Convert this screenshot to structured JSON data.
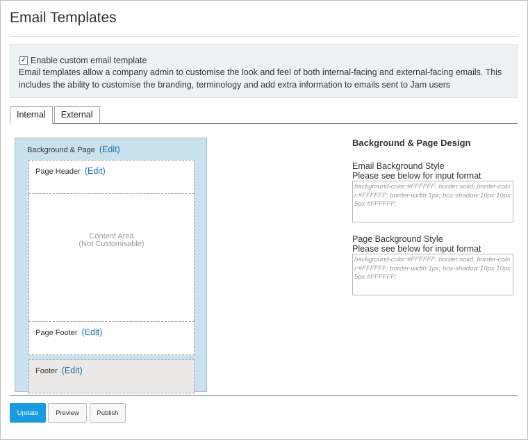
{
  "header": {
    "title": "Email Templates"
  },
  "info": {
    "enable_label": "Enable custom email template",
    "enable_checked": true,
    "description": "Email templates allow a company admin to customise the look and feel of both internal-facing and external-facing emails. This includes the ability to customise the branding, terminology and add extra information to emails sent to Jam users"
  },
  "tabs": [
    {
      "label": "Internal",
      "active": true
    },
    {
      "label": "External",
      "active": false
    }
  ],
  "layout": {
    "background_label": "Background & Page",
    "edit_label": "(Edit)",
    "page_header_label": "Page Header",
    "content_line1": "Content Area",
    "content_line2": "(Not Customisable)",
    "page_footer_label": "Page Footer",
    "footer_label": "Footer"
  },
  "design": {
    "heading": "Background & Page Design",
    "email_bg_title": "Email Background Style",
    "email_bg_sub": "Please see below for input format",
    "email_bg_placeholder": "background-color:#FFFFFF; border:solid; border-color:#FFFFFF; border-width:1px; box-shadow:10px 10px 5px #FFFFFF;",
    "page_bg_title": "Page Background Style",
    "page_bg_sub": "Please see below for input format",
    "page_bg_placeholder": "background-color:#FFFFFF; border:solid; border-color:#FFFFFF; border-width:1px; box-shadow:10px 10px 5px #FFFFFF;"
  },
  "actions": {
    "update": "Update",
    "preview": "Preview",
    "publish": "Publish"
  },
  "colors": {
    "primary": "#1a9ae0",
    "link": "#1a6fa8",
    "layout_bg": "#c9e2ee"
  }
}
